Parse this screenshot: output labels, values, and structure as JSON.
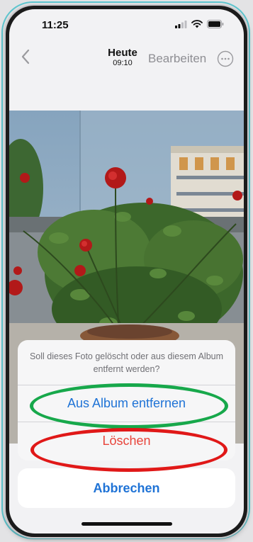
{
  "status_bar": {
    "time": "11:25"
  },
  "nav": {
    "title": "Heute",
    "subtitle": "09:10",
    "edit_label": "Bearbeiten"
  },
  "action_sheet": {
    "message": "Soll dieses Foto gelöscht oder aus diesem Album entfernt werden?",
    "remove_label": "Aus Album entfernen",
    "delete_label": "Löschen",
    "cancel_label": "Abbrechen"
  },
  "colors": {
    "accent": "#1f73d6",
    "destructive": "#e8443b",
    "highlight_green": "#17a84b",
    "highlight_red": "#e01818",
    "frame_outline": "#5ec6cf"
  },
  "icons": [
    "back-chevron-icon",
    "more-icon",
    "cellular-icon",
    "wifi-icon",
    "battery-icon"
  ]
}
